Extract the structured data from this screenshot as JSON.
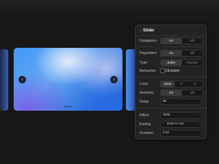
{
  "carousel": {
    "prev_arrow": "‹",
    "next_arrow": "›",
    "pagination_dots": 3,
    "active_dot": 1
  },
  "panel": {
    "title": "Slider",
    "chevron": "›",
    "navigation": {
      "label": "Navigation",
      "options": [
        "On",
        "Off"
      ],
      "selected": "On"
    },
    "pagination": {
      "label": "Pagination",
      "options": [
        "On",
        "Off"
      ],
      "selected": "On"
    },
    "type": {
      "label": "Type",
      "options": [
        "Bullet",
        "Fraction"
      ],
      "selected": "Bullet"
    },
    "behaviour": {
      "label": "Behaviour",
      "checkbox_label": "Clickable",
      "checked": false
    },
    "loop": {
      "label": "Loop",
      "options": [
        "None",
        "↶",
        "•+"
      ],
      "selected": "None"
    },
    "autoplay": {
      "label": "Autoplay",
      "options": [
        "On",
        "Off"
      ],
      "selected": "On"
    },
    "delay": {
      "label": "Delay",
      "value": "5s"
    },
    "effect": {
      "label": "Effect",
      "value": "Slide",
      "arrow": "›"
    },
    "easing": {
      "label": "Easing",
      "icon": "⟋",
      "value": "Ease in out",
      "arrow": "›"
    },
    "duration": {
      "label": "Duration",
      "value": "0.5s"
    }
  }
}
